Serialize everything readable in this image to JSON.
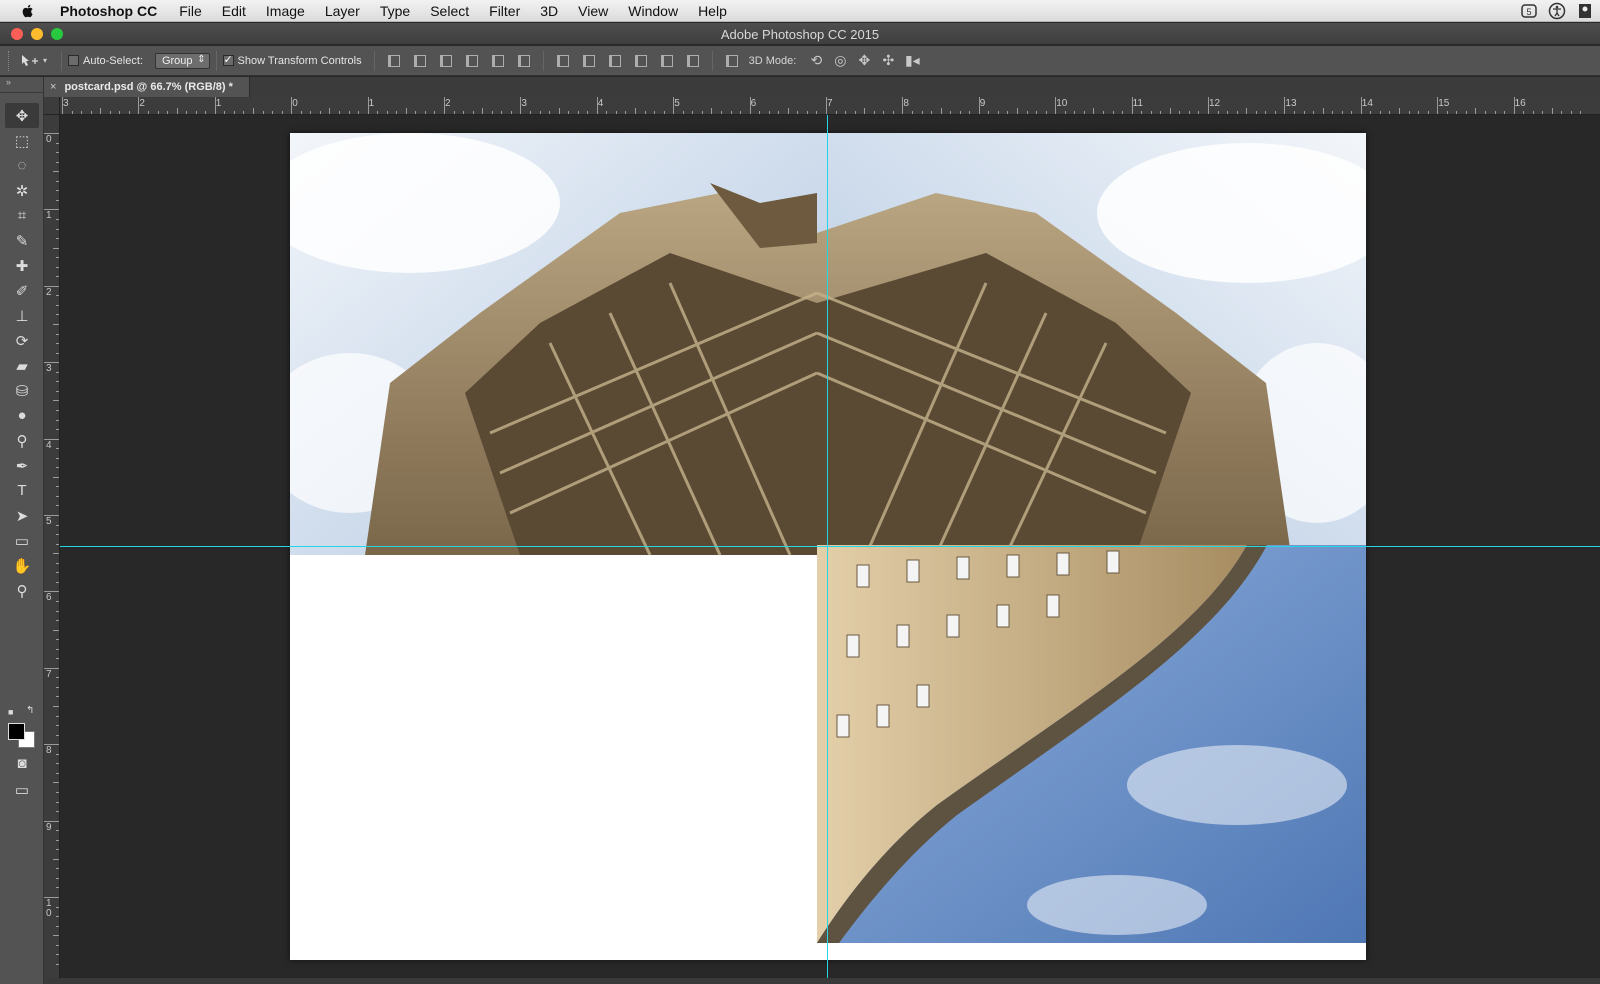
{
  "menubar": {
    "app": "Photoshop CC",
    "items": [
      "File",
      "Edit",
      "Image",
      "Layer",
      "Type",
      "Select",
      "Filter",
      "3D",
      "View",
      "Window",
      "Help"
    ]
  },
  "window": {
    "title": "Adobe Photoshop CC 2015"
  },
  "options": {
    "auto_select_label": "Auto-Select:",
    "auto_select_checked": false,
    "auto_select_target": "Group",
    "show_transform_label": "Show Transform Controls",
    "show_transform_checked": true,
    "mode3d_label": "3D Mode:"
  },
  "document": {
    "tab_title": "postcard.psd @ 66.7% (RGB/8) *"
  },
  "rulers": {
    "horizontal": [
      "3",
      "2",
      "1",
      "0",
      "1",
      "2",
      "3",
      "4",
      "5",
      "6",
      "7",
      "8",
      "9",
      "10",
      "11",
      "12",
      "13",
      "14",
      "15",
      "16"
    ],
    "vertical": [
      "0",
      "1",
      "2",
      "3",
      "4",
      "5",
      "6",
      "7",
      "8",
      "9",
      "1\n0"
    ]
  },
  "colors": {
    "guide": "#22d6e6",
    "foreground": "#000000",
    "background": "#ffffff"
  },
  "tools": [
    "move-icon",
    "marquee-icon",
    "lasso-icon",
    "magic-wand-icon",
    "crop-icon",
    "eyedropper-icon",
    "healing-brush-icon",
    "brush-icon",
    "clone-stamp-icon",
    "history-brush-icon",
    "eraser-icon",
    "paint-bucket-icon",
    "blur-icon",
    "dodge-icon",
    "pen-icon",
    "type-icon",
    "path-selection-icon",
    "rectangle-icon",
    "hand-icon",
    "zoom-icon"
  ]
}
